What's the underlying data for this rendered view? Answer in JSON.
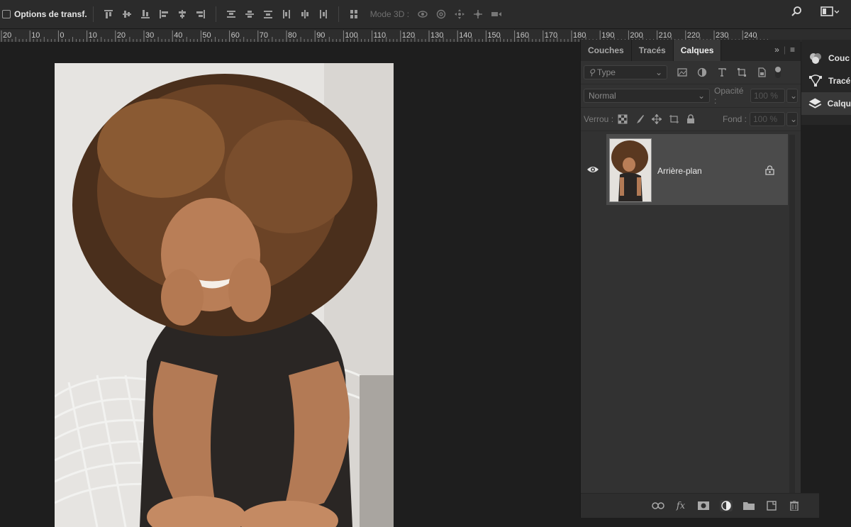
{
  "options_bar": {
    "transform_label": "Options de transf.",
    "mode3d_label": "Mode 3D :"
  },
  "ruler": {
    "labels": [
      "20",
      "10",
      "0",
      "10",
      "20",
      "30",
      "40",
      "50",
      "60",
      "70",
      "80",
      "90",
      "100",
      "110",
      "120",
      "130",
      "140",
      "150",
      "160",
      "170",
      "180",
      "190",
      "200",
      "210",
      "220",
      "230",
      "240"
    ]
  },
  "layers_panel": {
    "tabs": [
      "Couches",
      "Tracés",
      "Calques"
    ],
    "active_tab": "Calques",
    "filter_placeholder": "Type",
    "blend_mode": "Normal",
    "opacity_label": "Opacité :",
    "opacity_value": "100 %",
    "lock_label": "Verrou :",
    "fill_label": "Fond :",
    "fill_value": "100 %",
    "layers": [
      {
        "name": "Arrière-plan",
        "visible": true,
        "locked": true
      }
    ]
  },
  "dock": {
    "items": [
      "Couc",
      "Tracé",
      "Calqu"
    ]
  }
}
